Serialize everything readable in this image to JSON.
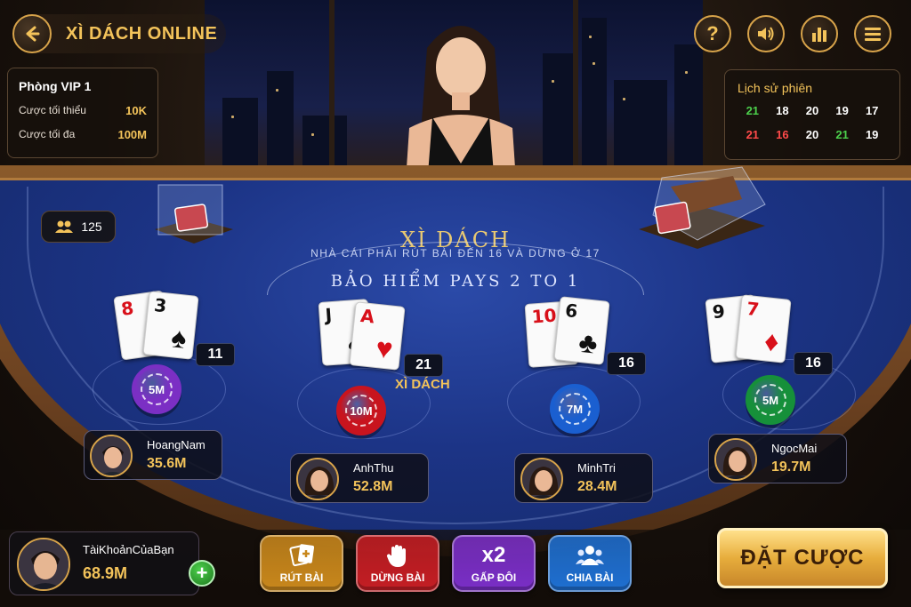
{
  "header": {
    "title": "XÌ DÁCH ONLINE"
  },
  "room": {
    "name": "Phòng VIP 1",
    "min_label": "Cược tối thiểu",
    "min_value": "10K",
    "max_label": "Cược tối đa",
    "max_value": "100M"
  },
  "history": {
    "title": "Lịch sử phiên",
    "rows": [
      [
        {
          "v": "21",
          "c": "#4cd04c"
        },
        {
          "v": "18",
          "c": "#ffffff"
        },
        {
          "v": "20",
          "c": "#ffffff"
        },
        {
          "v": "19",
          "c": "#ffffff"
        },
        {
          "v": "17",
          "c": "#ffffff"
        }
      ],
      [
        {
          "v": "21",
          "c": "#ff4a4a"
        },
        {
          "v": "16",
          "c": "#ff4a4a"
        },
        {
          "v": "20",
          "c": "#ffffff"
        },
        {
          "v": "21",
          "c": "#4cd04c"
        },
        {
          "v": "19",
          "c": "#ffffff"
        }
      ]
    ]
  },
  "players_online": "125",
  "table": {
    "title": "XÌ DÁCH",
    "rule": "NHÀ CÁI PHẢI RÚT BÀI ĐẾN 16 VÀ DỪNG Ở 17",
    "insurance": "BẢO HIỂM PAYS 2 TO 1"
  },
  "seats": [
    {
      "cards": [
        {
          "rank": "8",
          "suit": "♥",
          "color": "red"
        },
        {
          "rank": "3",
          "suit": "♠",
          "color": "blk"
        }
      ],
      "score": "11",
      "chip": "5M",
      "chip_color": "#7b2fc4",
      "name": "HoangNam",
      "money": "35.6M"
    },
    {
      "cards": [
        {
          "rank": "J",
          "suit": "♠",
          "color": "blk"
        },
        {
          "rank": "A",
          "suit": "♥",
          "color": "red"
        }
      ],
      "score": "21",
      "badge": "XÌ DÁCH",
      "chip": "10M",
      "chip_color": "#c8141e",
      "name": "AnhThu",
      "money": "52.8M"
    },
    {
      "cards": [
        {
          "rank": "10",
          "suit": "♦",
          "color": "red"
        },
        {
          "rank": "6",
          "suit": "♣",
          "color": "blk"
        }
      ],
      "score": "16",
      "chip": "7M",
      "chip_color": "#1a5fd0",
      "name": "MinhTri",
      "money": "28.4M"
    },
    {
      "cards": [
        {
          "rank": "9",
          "suit": "♠",
          "color": "blk"
        },
        {
          "rank": "7",
          "suit": "♦",
          "color": "red"
        }
      ],
      "score": "16",
      "chip": "5M",
      "chip_color": "#16903a",
      "name": "NgocMai",
      "money": "19.7M"
    }
  ],
  "me": {
    "name": "TàiKhoảnCủaBạn",
    "money": "68.9M"
  },
  "actions": [
    {
      "label": "RÚT BÀI",
      "icon": "draw-card-icon",
      "color": "#c8871c"
    },
    {
      "label": "DỪNG BÀI",
      "icon": "hand-stop-icon",
      "color": "#c41e24"
    },
    {
      "label": "GẤP ĐÔI",
      "icon": "x2",
      "color": "#7a2fc6"
    },
    {
      "label": "CHIA BÀI",
      "icon": "people-icon",
      "color": "#1f6fd0"
    }
  ],
  "bet_button": "ĐẶT CƯỢC",
  "colors": {
    "gold": "#f3c35a",
    "felt": "#1c3486"
  }
}
